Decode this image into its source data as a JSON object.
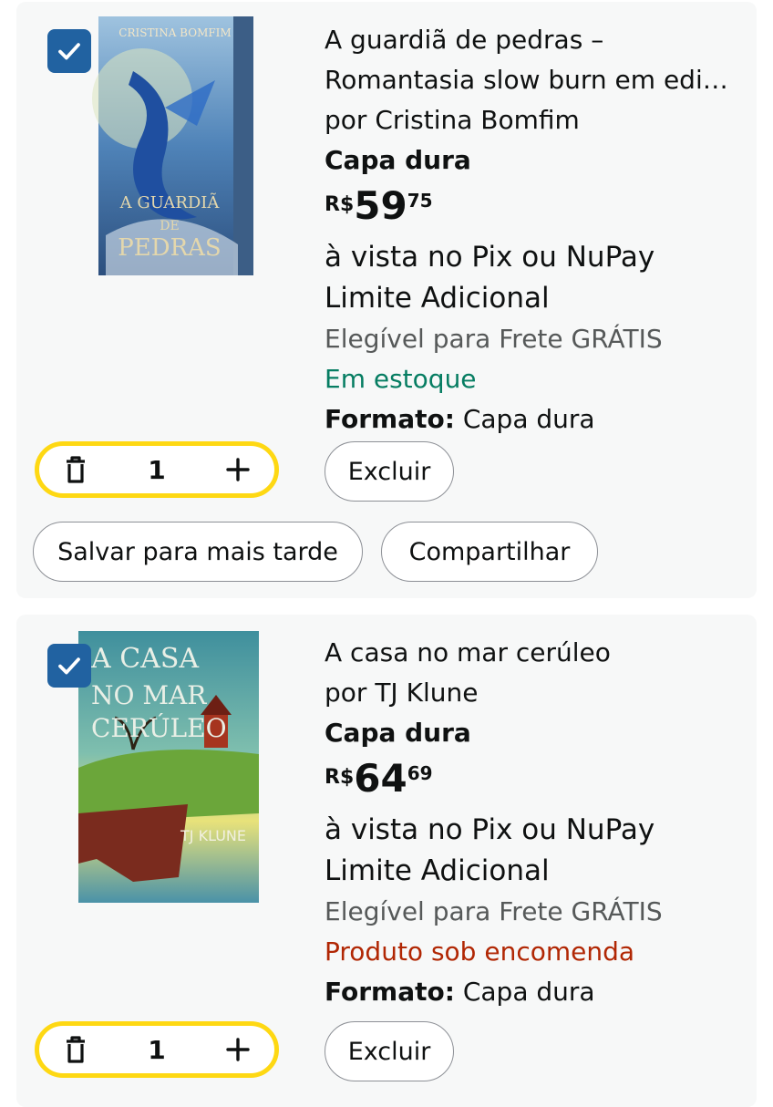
{
  "colors": {
    "accent_yellow": "#fed813",
    "checkbox_blue": "#2162a1",
    "in_stock_green": "#067d62",
    "backorder_red": "#b12704"
  },
  "items": [
    {
      "selected": true,
      "cover_text": [
        "CRISTINA BOMFIM",
        "A GUARDIÃ",
        "DE",
        "PEDRAS"
      ],
      "title": "A guardiã de pedras – Romantasia slow burn em edi…",
      "title_line1": "A guardiã de pedras –",
      "title_line2": "Romantasia slow burn em edi…",
      "author": "por Cristina Bomfim",
      "binding": "Capa dura",
      "price_currency": "R$",
      "price_int": "59",
      "price_cents": "75",
      "payment_line1": "à vista no Pix ou NuPay",
      "payment_line2": "Limite Adicional",
      "shipping": "Elegível para Frete GRÁTIS",
      "availability": "Em estoque",
      "format_label": "Formato:",
      "format_value": "Capa dura",
      "quantity": "1",
      "delete_label": "Excluir",
      "save_label": "Salvar para mais tarde",
      "share_label": "Compartilhar"
    },
    {
      "selected": true,
      "cover_text": [
        "A CASA",
        "NO MAR",
        "CERÚLEO",
        "TJ KLUNE"
      ],
      "title": "A casa no mar cerúleo",
      "author": "por TJ Klune",
      "binding": "Capa dura",
      "price_currency": "R$",
      "price_int": "64",
      "price_cents": "69",
      "payment_line1": "à vista no Pix ou NuPay",
      "payment_line2": "Limite Adicional",
      "shipping": "Elegível para Frete GRÁTIS",
      "availability": "Produto sob encomenda",
      "format_label": "Formato:",
      "format_value": "Capa dura",
      "quantity": "1",
      "delete_label": "Excluir"
    }
  ]
}
